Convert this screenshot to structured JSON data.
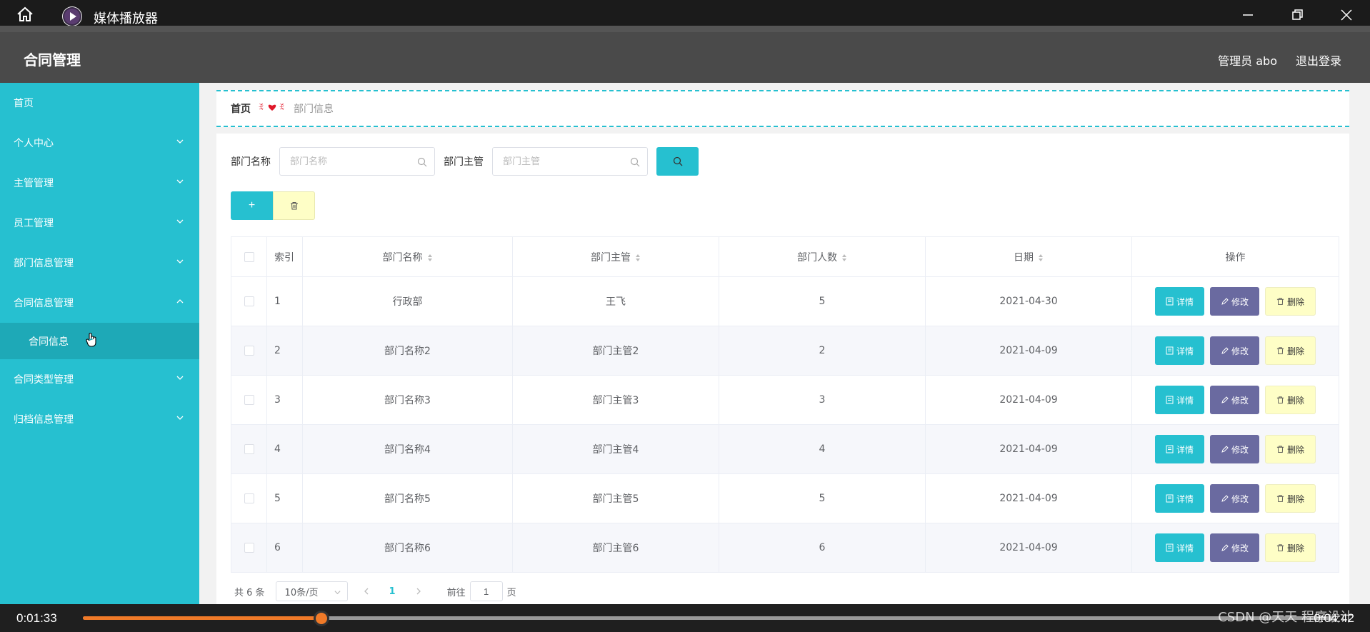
{
  "player": {
    "title": "媒体播放器",
    "time_current": "0:01:33",
    "time_total": "0:04:42",
    "progress": 0.191
  },
  "header": {
    "brand": "合同管理",
    "user": "管理员 abo",
    "logout": "退出登录"
  },
  "sidebar": {
    "items": [
      {
        "label": "首页",
        "has_chevron": false
      },
      {
        "label": "个人中心",
        "has_chevron": true
      },
      {
        "label": "主管管理",
        "has_chevron": true
      },
      {
        "label": "员工管理",
        "has_chevron": true
      },
      {
        "label": "部门信息管理",
        "has_chevron": true
      },
      {
        "label": "合同信息管理",
        "has_chevron": true,
        "expanded": true
      },
      {
        "label": "合同信息",
        "sub": true
      },
      {
        "label": "合同类型管理",
        "has_chevron": true
      },
      {
        "label": "归档信息管理",
        "has_chevron": true
      }
    ]
  },
  "breadcrumb": {
    "home": "首页",
    "current": "部门信息"
  },
  "search": {
    "label1": "部门名称",
    "placeholder1": "部门名称",
    "label2": "部门主管",
    "placeholder2": "部门主管"
  },
  "actions": {
    "add_label": "+"
  },
  "table": {
    "headers": [
      "索引",
      "部门名称",
      "部门主管",
      "部门人数",
      "日期",
      "操作"
    ],
    "rows": [
      [
        "1",
        "行政部",
        "王飞",
        "5",
        "2021-04-30"
      ],
      [
        "2",
        "部门名称2",
        "部门主管2",
        "2",
        "2021-04-09"
      ],
      [
        "3",
        "部门名称3",
        "部门主管3",
        "3",
        "2021-04-09"
      ],
      [
        "4",
        "部门名称4",
        "部门主管4",
        "4",
        "2021-04-09"
      ],
      [
        "5",
        "部门名称5",
        "部门主管5",
        "5",
        "2021-04-09"
      ],
      [
        "6",
        "部门名称6",
        "部门主管6",
        "6",
        "2021-04-09"
      ]
    ],
    "op_detail": "详情",
    "op_edit": "修改",
    "op_delete": "删除"
  },
  "pager": {
    "total": "共 6 条",
    "page_size": "10条/页",
    "current_page": "1",
    "goto_label": "前往",
    "goto_value": "1",
    "page_suffix": "页"
  },
  "watermark": "CSDN @天天 程序设计",
  "colors": {
    "accent": "#26c0d0",
    "edit": "#6a6aa0",
    "delete_bg": "#fefec6",
    "progress": "#f07a28"
  }
}
